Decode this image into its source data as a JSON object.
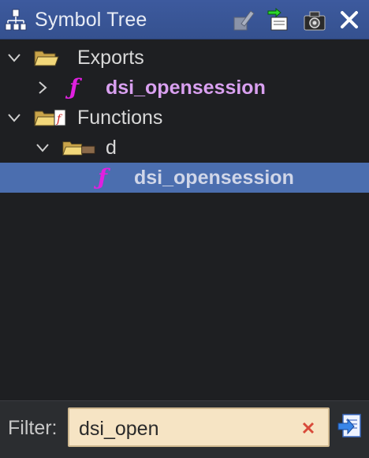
{
  "window": {
    "title": "Symbol Tree",
    "buttons": [
      {
        "name": "edit",
        "icon": "edit-pencil-icon"
      },
      {
        "name": "navigate",
        "icon": "navigate-in-icon"
      },
      {
        "name": "snapshot",
        "icon": "camera-snapshot-icon"
      },
      {
        "name": "close",
        "icon": "close-icon"
      }
    ]
  },
  "tree": {
    "nodes": [
      {
        "label": "Exports",
        "expanded": true,
        "icon": "folder-open-icon"
      },
      {
        "label": "dsi_opensession",
        "expanded": false,
        "icon": "function-icon"
      },
      {
        "label": "Functions",
        "expanded": true,
        "icon": "functions-folder-icon"
      },
      {
        "label": "d",
        "expanded": true,
        "icon": "folder-group-icon"
      },
      {
        "label": "dsi_opensession",
        "selected": true,
        "icon": "function-icon"
      }
    ]
  },
  "filter": {
    "label": "Filter:",
    "value": "dsi_open"
  },
  "colors": {
    "titlebar": "#3d5a9e",
    "selection": "#4b6eaf",
    "function_label": "#d9a0f0",
    "function_glyph": "#e020e0",
    "filter_bg": "#f6e4c4"
  }
}
